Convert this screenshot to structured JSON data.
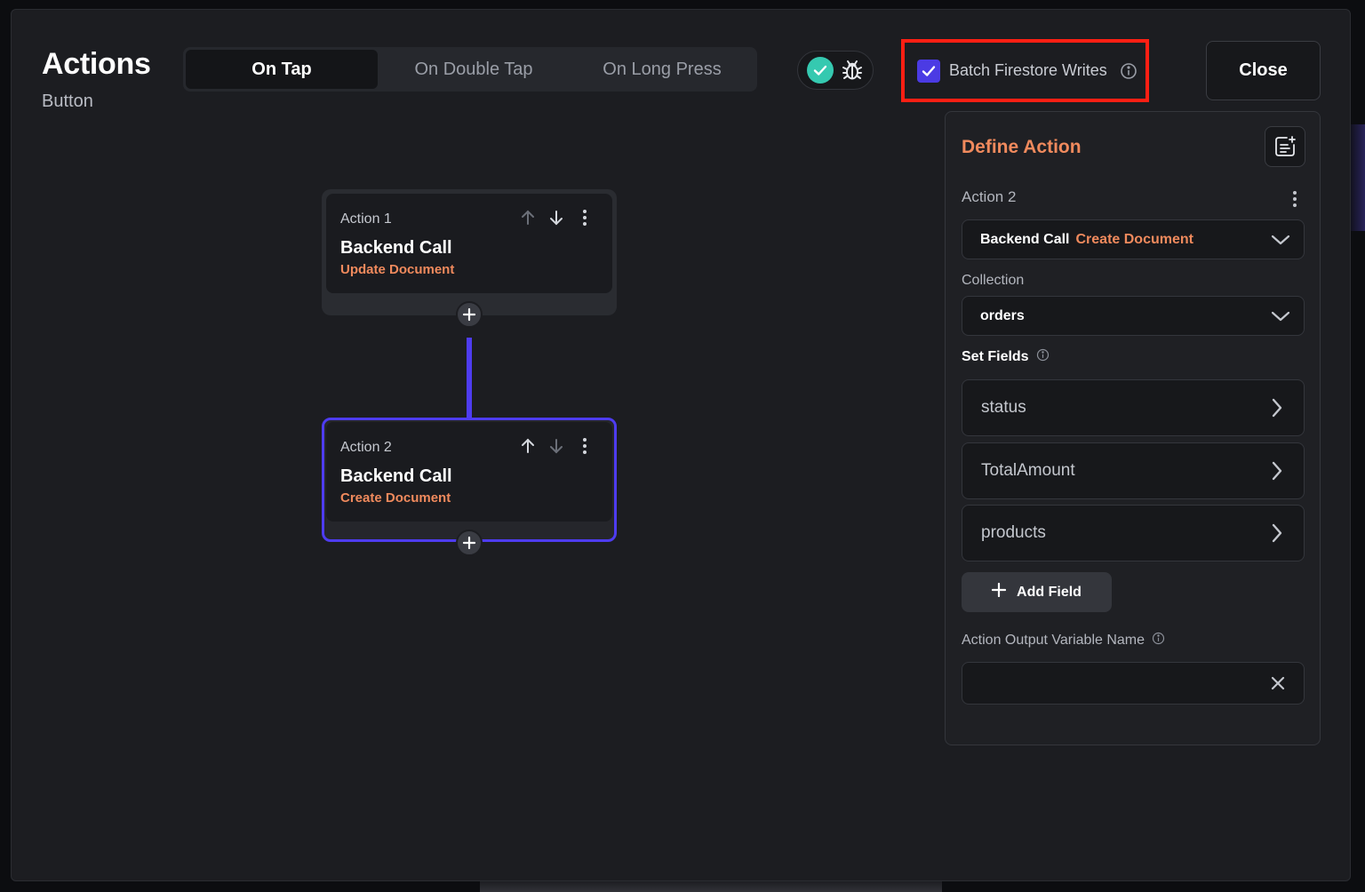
{
  "header": {
    "title": "Actions",
    "subtitle": "Button",
    "tabs": [
      {
        "label": "On Tap",
        "active": true
      },
      {
        "label": "On Double Tap",
        "active": false
      },
      {
        "label": "On Long Press",
        "active": false
      }
    ],
    "status_icons": [
      "check-circle-icon",
      "bug-icon"
    ],
    "batch_writes": {
      "label": "Batch Firestore Writes",
      "checked": true
    },
    "close_label": "Close"
  },
  "canvas": {
    "actions": [
      {
        "step": "Action 1",
        "title": "Backend Call",
        "subtitle": "Update Document",
        "selected": false
      },
      {
        "step": "Action 2",
        "title": "Backend Call",
        "subtitle": "Create Document",
        "selected": true
      }
    ]
  },
  "panel": {
    "title": "Define Action",
    "action_label": "Action 2",
    "action_type": {
      "main": "Backend Call",
      "sub": "Create Document"
    },
    "collection_label": "Collection",
    "collection_value": "orders",
    "set_fields_label": "Set Fields",
    "fields": [
      "status",
      "TotalAmount",
      "products"
    ],
    "add_field_label": "Add Field",
    "output_var_label": "Action Output Variable Name",
    "output_var_value": ""
  },
  "colors": {
    "accent": "#4e3cf0",
    "orange": "#f08a5d",
    "success": "#35c9b0",
    "highlight": "#ff1f13"
  }
}
